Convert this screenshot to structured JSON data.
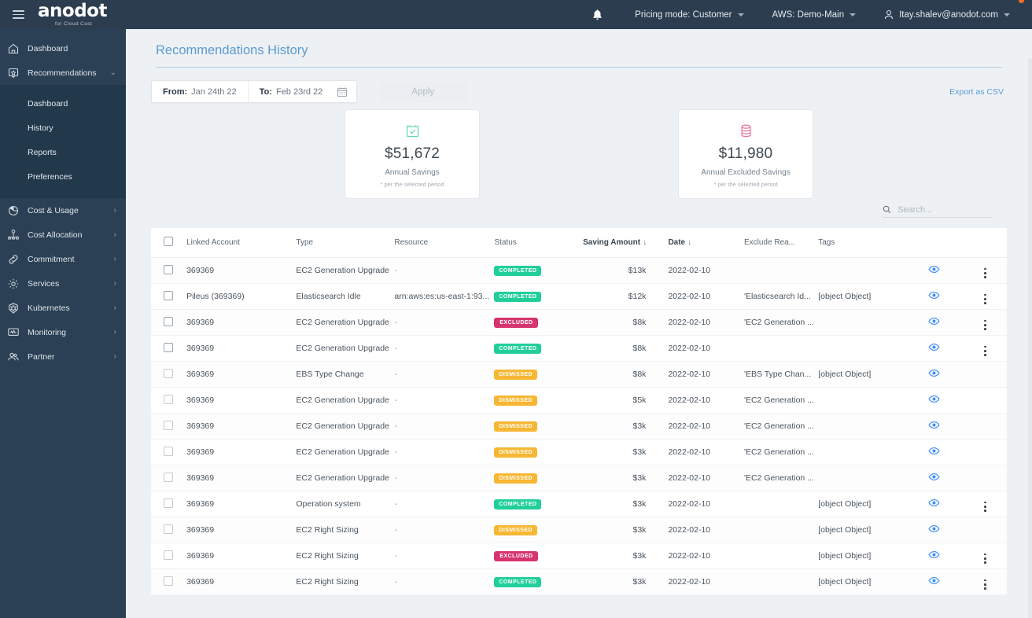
{
  "topbar": {
    "menu_icon": "hamburger-icon",
    "brand_name": "anodot",
    "brand_tagline": "for Cloud Cost",
    "bell_icon": "bell-icon",
    "pricing_mode": "Pricing mode: Customer",
    "account": "AWS: Demo-Main",
    "user_icon": "user-icon",
    "user_email": "Itay.shalev@anodot.com"
  },
  "sidebar": {
    "items": [
      {
        "label": "Dashboard",
        "icon": "home-icon",
        "has_arrow": false,
        "expanded": false
      },
      {
        "label": "Recommendations",
        "icon": "recommendations-icon",
        "has_arrow": true,
        "expanded": true
      }
    ],
    "submenu": [
      {
        "label": "Dashboard"
      },
      {
        "label": "History"
      },
      {
        "label": "Reports"
      },
      {
        "label": "Preferences"
      }
    ],
    "lower_items": [
      {
        "label": "Cost & Usage",
        "icon": "pie-chart-icon"
      },
      {
        "label": "Cost Allocation",
        "icon": "hierarchy-icon"
      },
      {
        "label": "Commitment",
        "icon": "link-icon"
      },
      {
        "label": "Services",
        "icon": "gear-icon"
      },
      {
        "label": "Kubernetes",
        "icon": "kubernetes-icon"
      },
      {
        "label": "Monitoring",
        "icon": "monitor-icon"
      },
      {
        "label": "Partner",
        "icon": "people-icon"
      }
    ]
  },
  "page": {
    "title": "Recommendations History"
  },
  "filters": {
    "from_label": "From:",
    "from_value": "Jan 24th 22",
    "to_label": "To:",
    "to_value": "Feb 23rd 22",
    "calendar_icon": "calendar-icon",
    "apply_label": "Apply",
    "export_label": "Export as CSV"
  },
  "cards": [
    {
      "icon": "calendar-check-icon",
      "value": "$51,672",
      "label": "Annual Savings",
      "note": "* per the selected period",
      "color": "#5fd6b4"
    },
    {
      "icon": "database-icon",
      "value": "$11,980",
      "label": "Annual Excluded Savings",
      "note": "* per the selected period",
      "color": "#e8739f"
    }
  ],
  "search": {
    "placeholder": "Search...",
    "value": "",
    "icon": "search-icon"
  },
  "table": {
    "columns": [
      {
        "key": "checkbox",
        "label": ""
      },
      {
        "key": "linked_account",
        "label": "Linked Account"
      },
      {
        "key": "type",
        "label": "Type"
      },
      {
        "key": "resource",
        "label": "Resource"
      },
      {
        "key": "status",
        "label": "Status"
      },
      {
        "key": "saving_amount",
        "label": "Saving Amount",
        "sort": "↓",
        "bold": true
      },
      {
        "key": "date",
        "label": "Date",
        "sort": "↓",
        "bold": true
      },
      {
        "key": "exclude_reason",
        "label": "Exclude Rea..."
      },
      {
        "key": "tags",
        "label": "Tags"
      }
    ],
    "rows": [
      {
        "account": "369369",
        "type": "EC2 Generation Upgrade",
        "resource": "-",
        "status": "COMPLETED",
        "status_class": "completed",
        "saving": "$13k",
        "date": "2022-02-10",
        "exclude": "",
        "tags": "",
        "has_menu": true
      },
      {
        "account": "Pileus (369369)",
        "type": "Elasticsearch Idle",
        "resource": "arn:aws:es:us-east-1:93...",
        "status": "COMPLETED",
        "status_class": "completed",
        "saving": "$12k",
        "date": "2022-02-10",
        "exclude": "'Elasticsearch Id...",
        "tags": "[object Object]",
        "has_menu": true
      },
      {
        "account": "369369",
        "type": "EC2 Generation Upgrade",
        "resource": "-",
        "status": "EXCLUDED",
        "status_class": "excluded",
        "saving": "$8k",
        "date": "2022-02-10",
        "exclude": "'EC2 Generation ...",
        "tags": "",
        "has_menu": true
      },
      {
        "account": "369369",
        "type": "EC2 Generation Upgrade",
        "resource": "-",
        "status": "COMPLETED",
        "status_class": "completed",
        "saving": "$8k",
        "date": "2022-02-10",
        "exclude": "",
        "tags": "",
        "has_menu": true
      },
      {
        "account": "369369",
        "type": "EBS Type Change",
        "resource": "-",
        "status": "DISMISSED",
        "status_class": "dismissed",
        "saving": "$8k",
        "date": "2022-02-10",
        "exclude": "'EBS Type Chan...",
        "tags": "[object Object]",
        "has_menu": false
      },
      {
        "account": "369369",
        "type": "EC2 Generation Upgrade",
        "resource": "-",
        "status": "DISMISSED",
        "status_class": "dismissed",
        "saving": "$5k",
        "date": "2022-02-10",
        "exclude": "'EC2 Generation ...",
        "tags": "",
        "has_menu": false
      },
      {
        "account": "369369",
        "type": "EC2 Generation Upgrade",
        "resource": "-",
        "status": "DISMISSED",
        "status_class": "dismissed",
        "saving": "$3k",
        "date": "2022-02-10",
        "exclude": "'EC2 Generation ...",
        "tags": "",
        "has_menu": false
      },
      {
        "account": "369369",
        "type": "EC2 Generation Upgrade",
        "resource": "-",
        "status": "DISMISSED",
        "status_class": "dismissed",
        "saving": "$3k",
        "date": "2022-02-10",
        "exclude": "'EC2 Generation ...",
        "tags": "",
        "has_menu": false
      },
      {
        "account": "369369",
        "type": "EC2 Generation Upgrade",
        "resource": "-",
        "status": "DISMISSED",
        "status_class": "dismissed",
        "saving": "$3k",
        "date": "2022-02-10",
        "exclude": "'EC2 Generation ...",
        "tags": "",
        "has_menu": false
      },
      {
        "account": "369369",
        "type": "Operation system",
        "resource": "-",
        "status": "COMPLETED",
        "status_class": "completed",
        "saving": "$3k",
        "date": "2022-02-10",
        "exclude": "",
        "tags": "[object Object]",
        "has_menu": true
      },
      {
        "account": "369369",
        "type": "EC2 Right Sizing",
        "resource": "-",
        "status": "DISMISSED",
        "status_class": "dismissed",
        "saving": "$3k",
        "date": "2022-02-10",
        "exclude": "",
        "tags": "[object Object]",
        "has_menu": false
      },
      {
        "account": "369369",
        "type": "EC2 Right Sizing",
        "resource": "-",
        "status": "EXCLUDED",
        "status_class": "excluded",
        "saving": "$3k",
        "date": "2022-02-10",
        "exclude": "",
        "tags": "[object Object]",
        "has_menu": true
      },
      {
        "account": "369369",
        "type": "EC2 Right Sizing",
        "resource": "-",
        "status": "COMPLETED",
        "status_class": "completed",
        "saving": "$3k",
        "date": "2022-02-10",
        "exclude": "",
        "tags": "[object Object]",
        "has_menu": true
      }
    ],
    "row_icons": {
      "eye": "eye-icon",
      "menu": "kebab-menu-icon",
      "checkbox": "checkbox-icon"
    }
  },
  "colors": {
    "accent_blue": "#5b9bd1",
    "sidebar_bg": "#2b4055",
    "topbar_bg": "#2b3d4f",
    "brand_orange": "#f37021",
    "status_completed": "#21cf9a",
    "status_excluded": "#d6356f",
    "status_dismissed": "#f7b733"
  }
}
